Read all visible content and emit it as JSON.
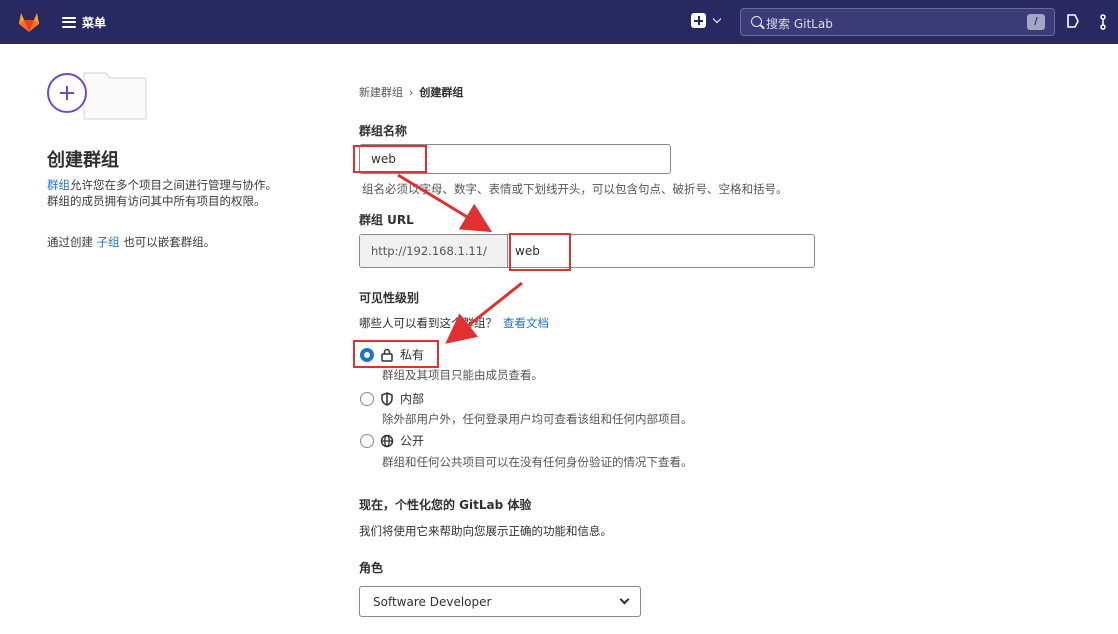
{
  "navbar": {
    "menu_label": "菜单",
    "search_placeholder": "搜索 GitLab",
    "search_shortcut": "/"
  },
  "sidebar": {
    "title": "创建群组",
    "desc_link": "群组",
    "desc_text_1": "允许您在多个项目之间进行管理与协作。",
    "desc_text_2": "群组的成员拥有访问其中所有项目的权限。",
    "sub_prefix": "通过创建",
    "sub_link": "子组",
    "sub_suffix": "也可以嵌套群组。"
  },
  "breadcrumb": {
    "parent": "新建群组",
    "separator": "›",
    "current": "创建群组"
  },
  "form": {
    "group_name_label": "群组名称",
    "group_name_value": "web",
    "group_name_help": "组名必须以字母、数字、表情或下划线开头，可以包含句点、破折号、空格和括号。",
    "group_url_label": "群组 URL",
    "group_url_prefix": "http://192.168.1.11/",
    "group_url_value": "web",
    "visibility_label": "可见性级别",
    "visibility_help": "哪些人可以看到这个群组？",
    "visibility_doc_link": "查看文档",
    "visibility_options": [
      {
        "label": "私有",
        "desc": "群组及其项目只能由成员查看。",
        "checked": true,
        "icon": "lock-icon"
      },
      {
        "label": "内部",
        "desc": "除外部用户外，任何登录用户均可查看该组和任何内部项目。",
        "checked": false,
        "icon": "shield-icon"
      },
      {
        "label": "公开",
        "desc": "群组和任何公共项目可以在没有任何身份验证的情况下查看。",
        "checked": false,
        "icon": "globe-icon"
      }
    ],
    "personalize_title": "现在，个性化您的 GitLab 体验",
    "personalize_help": "我们将使用它来帮助向您展示正确的功能和信息。",
    "role_label": "角色",
    "role_value": "Software Developer"
  },
  "colors": {
    "navbar": "#292961",
    "link": "#1f75cb",
    "annotation": "#e03030"
  }
}
